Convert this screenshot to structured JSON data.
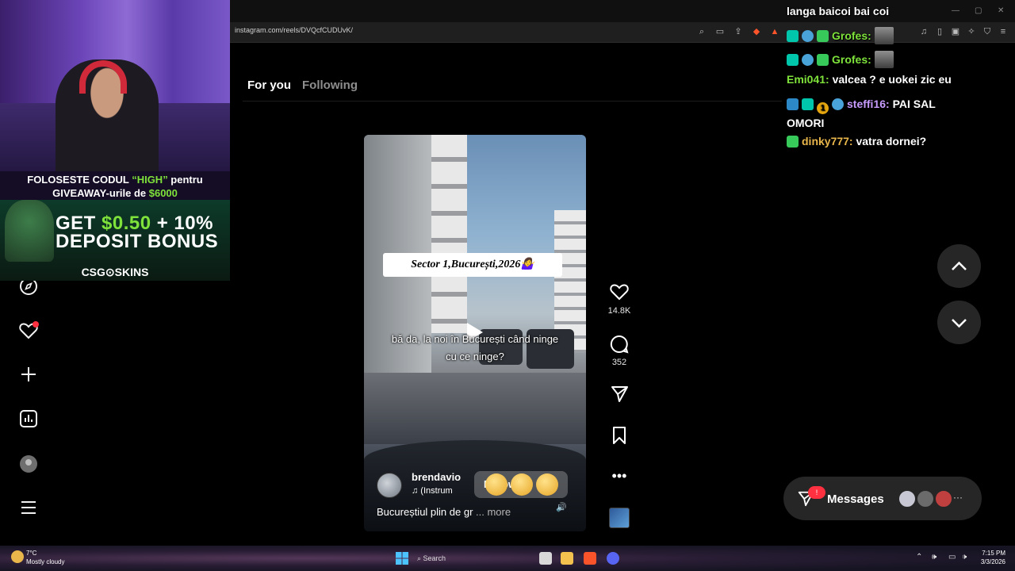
{
  "browser": {
    "url": "instagram.com/reels/DVQcfCUDUvK/"
  },
  "tabs": {
    "for_you": "For you",
    "following": "Following"
  },
  "reel": {
    "caption_sign": "Sector 1,București,2026🤷‍♀️",
    "subtitle_line1": "bă da, la noi în București când ninge",
    "subtitle_line2": "cu ce ninge?",
    "author": "brendavio",
    "music": "♫ (Instrum",
    "follow_label": "Follow",
    "description": "Bucureștiul plin de gr",
    "more": "... more",
    "likes": "14.8K",
    "comments": "352"
  },
  "messages": {
    "label": "Messages",
    "badge": "!"
  },
  "stream_overlay": {
    "banner_line1_pre": "FOLOSESTE CODUL ",
    "banner_code": "“HIGH”",
    "banner_line1_post": " pentru",
    "banner_line2_pre": "GIVEAWAY-urile de ",
    "banner_amount": "$6000",
    "promo_line1_pre": "GET ",
    "promo_line1_amount": "$0.50",
    "promo_line1_post": " + 10%",
    "promo_line2": "DEPOSIT BONUS",
    "promo_brand": "CSG⊙SKINS"
  },
  "chat": [
    {
      "user": "",
      "text": "langa baicoi bai coi",
      "color": "#ffffff"
    },
    {
      "user": "Grofes:",
      "text": "",
      "color": "#7ee23b"
    },
    {
      "user": "Grofes:",
      "text": "",
      "color": "#7ee23b"
    },
    {
      "user": "Emi041:",
      "text": "valcea ? e uokei zic eu",
      "color": "#7ee23b"
    },
    {
      "user": "steffi16:",
      "text": "PAI SAL",
      "text2": "OMORI",
      "color": "#c79bff",
      "coin": "1"
    },
    {
      "user": "dinky777:",
      "text": "vatra dornei?",
      "color": "#e8b64b"
    }
  ],
  "taskbar": {
    "weather_temp": "7°C",
    "weather_desc": "Mostly cloudy",
    "search": "Search",
    "time": "7:15 PM",
    "date": "3/3/2026"
  },
  "colors": {
    "accent_green": "#7ee23b",
    "notification_red": "#ff3040"
  },
  "icons": [
    "compass-icon",
    "heart-icon",
    "plus-icon",
    "analytics-icon",
    "profile-icon",
    "menu-icon",
    "like-icon",
    "comment-icon",
    "share-icon",
    "bookmark-icon",
    "more-icon",
    "chevron-up-icon",
    "chevron-down-icon",
    "messages-icon"
  ]
}
